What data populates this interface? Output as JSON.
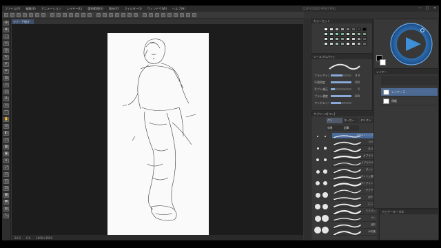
{
  "app": {
    "title": "CLIP STUDIO PAINT PRO",
    "menus": [
      "ファイル(F)",
      "編集(E)",
      "アニメーション",
      "レイヤー(L)",
      "選択範囲(S)",
      "表示(V)",
      "フィルター(I)",
      "ウィンドウ(W)",
      "ヘルプ(H)"
    ],
    "window_buttons": [
      "—",
      "□",
      "✕"
    ]
  },
  "document": {
    "tab_label": "ラフ・下描き",
    "paper_color": "#fafafa"
  },
  "status": {
    "zoom": "24.9",
    "angle": "0.0",
    "coords": "1800×3600"
  },
  "panels": {
    "color_set_title": "カラーセット",
    "tool_property_title": "ツールプロパティ",
    "tool_property_rows": [
      {
        "label": "ブラシサイズ",
        "value": "9.0",
        "level": 0.55
      },
      {
        "label": "不透明度",
        "value": "100",
        "level": 1.0
      },
      {
        "label": "手ブレ補正",
        "value": "5",
        "level": 0.2
      },
      {
        "label": "ブラシ濃度",
        "value": "100",
        "level": 1.0
      },
      {
        "label": "アンチエイリアス",
        "value": "",
        "level": 0.5
      }
    ],
    "sub_tool_title": "サブツール[ペン]",
    "sub_tool_tabs": [
      "ペン",
      "マーカー",
      "ミリペン",
      "効果",
      "鉛筆"
    ],
    "brushes": [
      "Nanaメインペン",
      "Gペン",
      "丸ペン",
      "カブラペン",
      "リアルGペン",
      "ガッシュ",
      "ガッシュ細筆",
      "タップインク",
      "ザクザク",
      "ぼかし",
      "にじみ",
      "ミリペン",
      "ペン",
      "油彩",
      "水彩筆"
    ],
    "layer_title": "レイヤー",
    "layers": [
      {
        "name": "レイヤー 2",
        "selected": true
      },
      {
        "name": "用紙",
        "selected": false
      }
    ],
    "navigator_label": "ナビゲーター 0.0"
  },
  "colors": {
    "accent": "#3c8fd8",
    "main_color": "#000000",
    "sub_color": "#ffffff",
    "swatches": [
      "#ffffff",
      "#e0e0e0",
      "#c0c0c0",
      "#a0a0a0",
      "#808080",
      "#606060",
      "#404040",
      "#000000",
      "#bfe3d2",
      "#a8d4c0",
      "#8fc4ae",
      "#6fb094",
      "#c8d8c8",
      "#b0c8b4",
      "#98b4a0",
      "#7a9a86",
      "#d0e0d8",
      "#b8ccc4",
      "#9cb4aa",
      "#80998e",
      "#e8e8e8",
      "#cccccc",
      "#9a9a9a",
      "#5c5c5c",
      "#dfe8e4",
      "#c4d4cc",
      "#a6bcb2",
      "#889e94",
      "#f0f0f0",
      "#d6d6d6",
      "#b2b2b2",
      "#6a6a6a"
    ]
  }
}
